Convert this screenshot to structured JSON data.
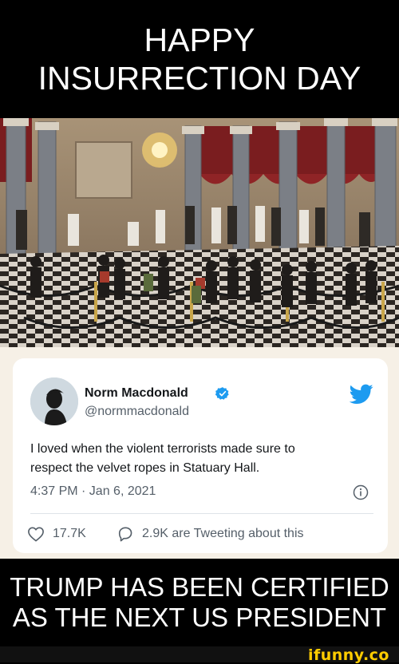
{
  "top_caption": {
    "line1": "HAPPY",
    "line2": "INSURRECTION DAY"
  },
  "photo": {
    "description_icon": "statuary-hall-photo"
  },
  "tweet": {
    "author_name": "Norm Macdonald",
    "author_handle": "@normmacdonald",
    "verified": true,
    "text_line1": "I loved when the violent terrorists made sure to",
    "text_line2": "respect the velvet ropes in Statuary Hall.",
    "timestamp": "4:37 PM · Jan 6, 2021",
    "likes": "17.7K",
    "replies": "2.9K are Tweeting about this",
    "colors": {
      "accent": "#1d9bf0",
      "text": "#14171a",
      "muted": "#555f69"
    }
  },
  "bottom_caption": {
    "line1": "TRUMP HAS BEEN CERTIFIED",
    "line2": "AS THE NEXT US PRESIDENT"
  },
  "watermark": "ifunny.co"
}
